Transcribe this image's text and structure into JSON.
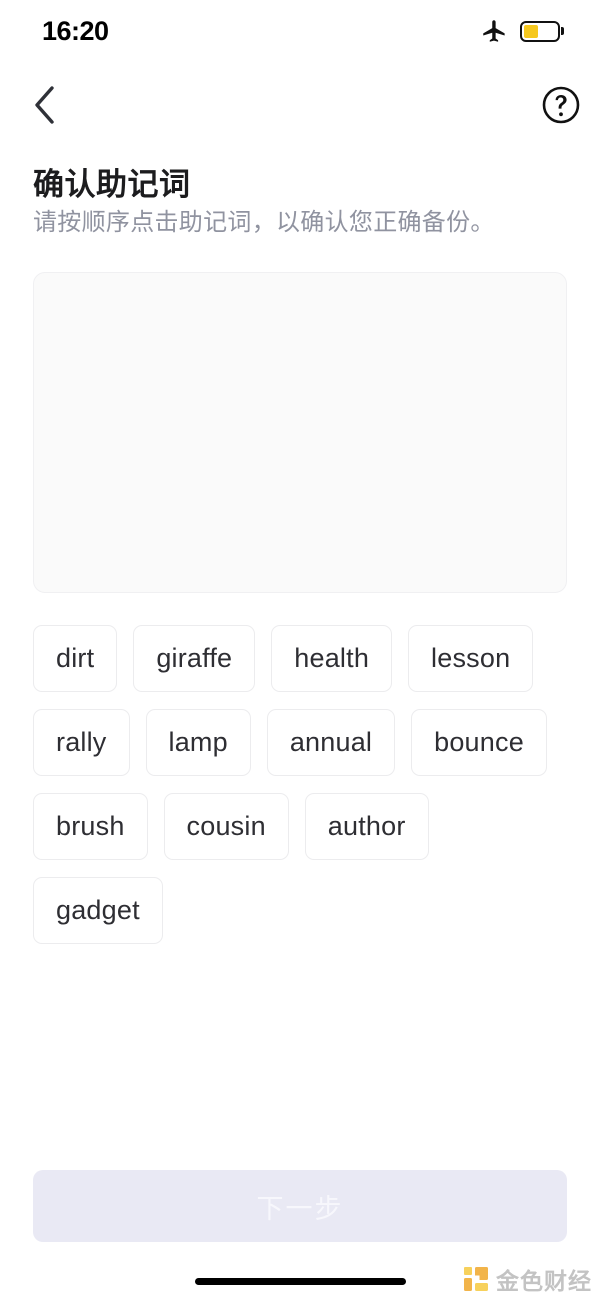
{
  "status_bar": {
    "time": "16:20",
    "airplane_icon": "airplane-mode-icon",
    "battery_icon": "battery-low-power-icon",
    "battery_level_percent": 45,
    "battery_fill_color": "#f6c81e"
  },
  "nav": {
    "back_icon": "chevron-left-icon",
    "back_label": "<",
    "help_icon": "question-mark-circle-icon",
    "help_label": "?"
  },
  "header": {
    "title": "确认助记词",
    "subtitle": "请按顺序点击助记词，以确认您正确备份。"
  },
  "answer_area": {
    "name": "selected-words-box",
    "selected_words": [],
    "background_color": "#fafafa",
    "border_color": "#f0f0f2"
  },
  "word_pool": {
    "words": [
      "dirt",
      "giraffe",
      "health",
      "lesson",
      "rally",
      "lamp",
      "annual",
      "bounce",
      "brush",
      "cousin",
      "author",
      "gadget"
    ],
    "count": 12,
    "chip_text_color": "#2e2e33",
    "chip_border_color": "#ececee"
  },
  "footer": {
    "next_label": "下一步",
    "next_enabled": false,
    "next_bg_color": "#e9e9f4",
    "next_text_color": "#f7f7fc"
  },
  "watermark": {
    "text": "金色财经",
    "logo_color": "#f0a72b",
    "logo_color_light": "#f6c940",
    "text_color": "#b9b9b9"
  }
}
